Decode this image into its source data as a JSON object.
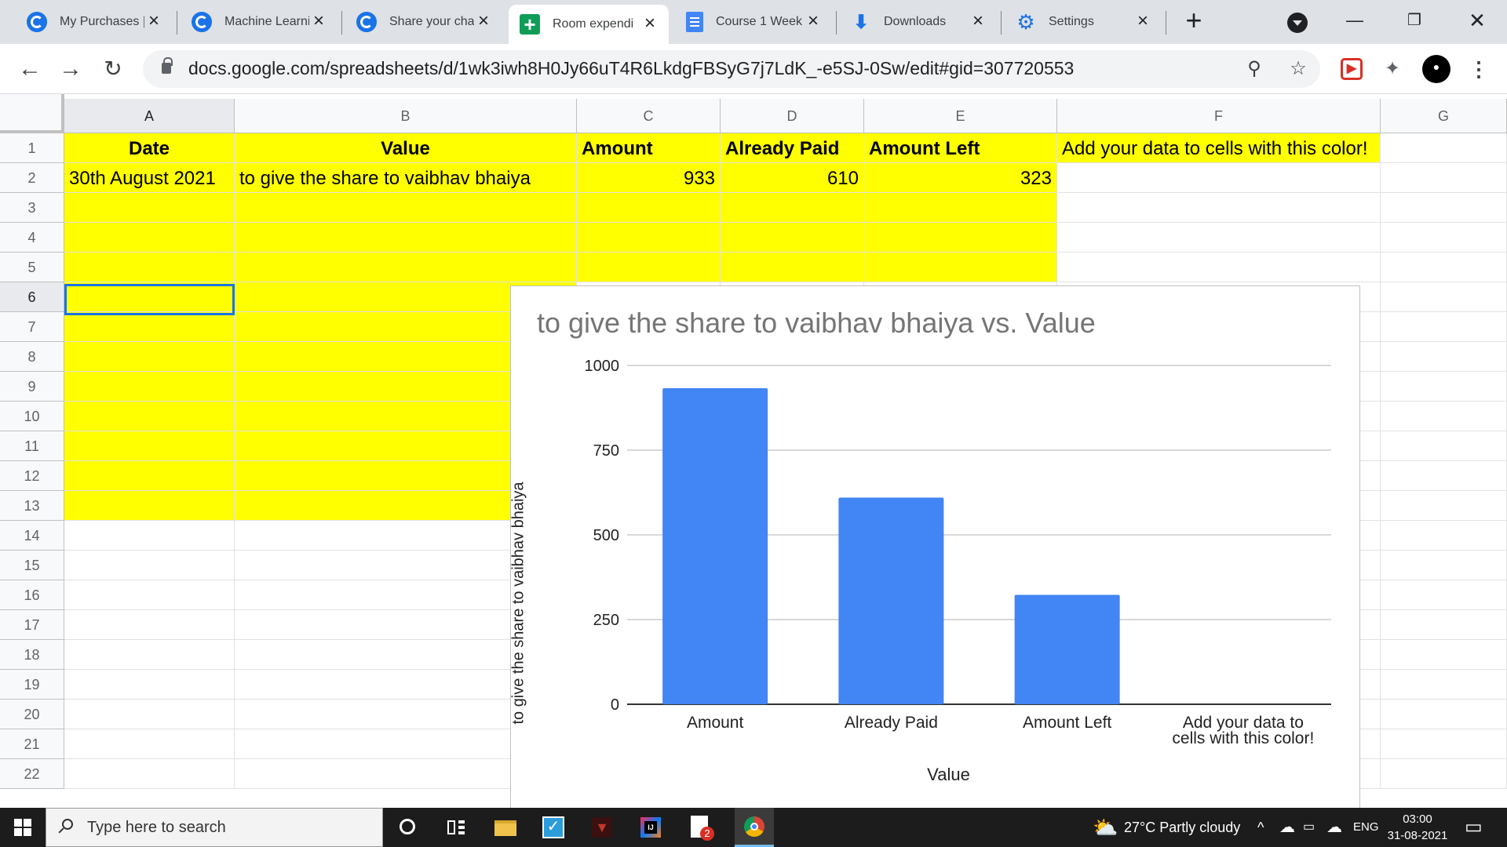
{
  "browser": {
    "tabs": [
      {
        "title": "My Purchases |",
        "icon": "chrome-icon",
        "active": false
      },
      {
        "title": "Machine Learni",
        "icon": "chrome-icon",
        "active": false
      },
      {
        "title": "Share your cha",
        "icon": "chrome-icon",
        "active": false
      },
      {
        "title": "Room expendi",
        "icon": "sheets-icon",
        "active": true
      },
      {
        "title": "Course 1 Week",
        "icon": "docs-icon",
        "active": false
      },
      {
        "title": "Downloads",
        "icon": "download-icon",
        "active": false
      },
      {
        "title": "Settings",
        "icon": "gear-icon",
        "active": false
      }
    ],
    "url": "docs.google.com/spreadsheets/d/1wk3iwh8H0Jy66uT4R6LkdgFBSyG7j7LdK_-e5SJ-0Sw/edit#gid=307720553"
  },
  "sheet": {
    "columns": [
      "A",
      "B",
      "C",
      "D",
      "E",
      "F",
      "G"
    ],
    "rows": [
      "1",
      "2",
      "3",
      "4",
      "5",
      "6",
      "7",
      "8",
      "9",
      "10",
      "11",
      "12",
      "13",
      "14",
      "15",
      "16",
      "17",
      "18",
      "19",
      "20",
      "21",
      "22"
    ],
    "header_row": {
      "a": "Date",
      "b": "Value",
      "c": "Amount",
      "d": "Already Paid",
      "e": "Amount Left",
      "f": "Add your data to cells with this color!"
    },
    "row2": {
      "a": "30th August 2021",
      "b": "to give the share to vaibhav bhaiya",
      "c": "933",
      "d": "610",
      "e": "323"
    },
    "highlight_color": "#ffff00",
    "selected_cell": "A6"
  },
  "chart_data": {
    "type": "bar",
    "title": "to give the share to vaibhav bhaiya  vs. Value",
    "xlabel": "Value",
    "ylabel": "to give the share to vaibhav bhaiya",
    "categories": [
      "Amount",
      "Already Paid",
      "Amount Left",
      "Add your data to cells with this color!"
    ],
    "values": [
      933,
      610,
      323,
      0
    ],
    "ylim": [
      0,
      1000
    ],
    "yticks": [
      "0",
      "250",
      "500",
      "750",
      "1000"
    ],
    "bar_color": "#4285f4",
    "grid": true
  },
  "taskbar": {
    "search_placeholder": "Type here to search",
    "weather": "27°C  Partly cloudy",
    "language": "ENG",
    "time": "03:00",
    "date": "31-08-2021",
    "badge_count": "2"
  }
}
